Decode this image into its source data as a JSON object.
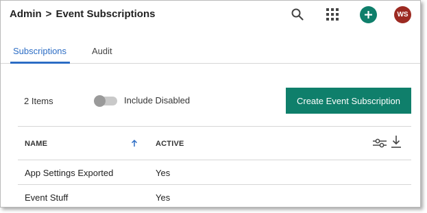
{
  "header": {
    "breadcrumb_root": "Admin",
    "breadcrumb_sep": ">",
    "breadcrumb_page": "Event Subscriptions",
    "avatar_initials": "WS",
    "icons": [
      "search-icon",
      "apps-grid-icon",
      "add-icon"
    ]
  },
  "tabs": [
    {
      "label": "Subscriptions",
      "active": true
    },
    {
      "label": "Audit",
      "active": false
    }
  ],
  "toolbar": {
    "items_count": "2 Items",
    "include_disabled_label": "Include Disabled",
    "include_disabled_on": false,
    "create_button": "Create Event Subscription"
  },
  "table": {
    "columns": [
      "NAME",
      "ACTIVE"
    ],
    "sort_column": "NAME",
    "sort_direction": "ascending",
    "rows": [
      {
        "name": "App Settings Exported",
        "active": "Yes"
      },
      {
        "name": "Event Stuff",
        "active": "Yes"
      }
    ]
  },
  "colors": {
    "accent_blue": "#2b6cc4",
    "primary_green": "#0f7f6b",
    "avatar_red": "#9c2a22"
  }
}
